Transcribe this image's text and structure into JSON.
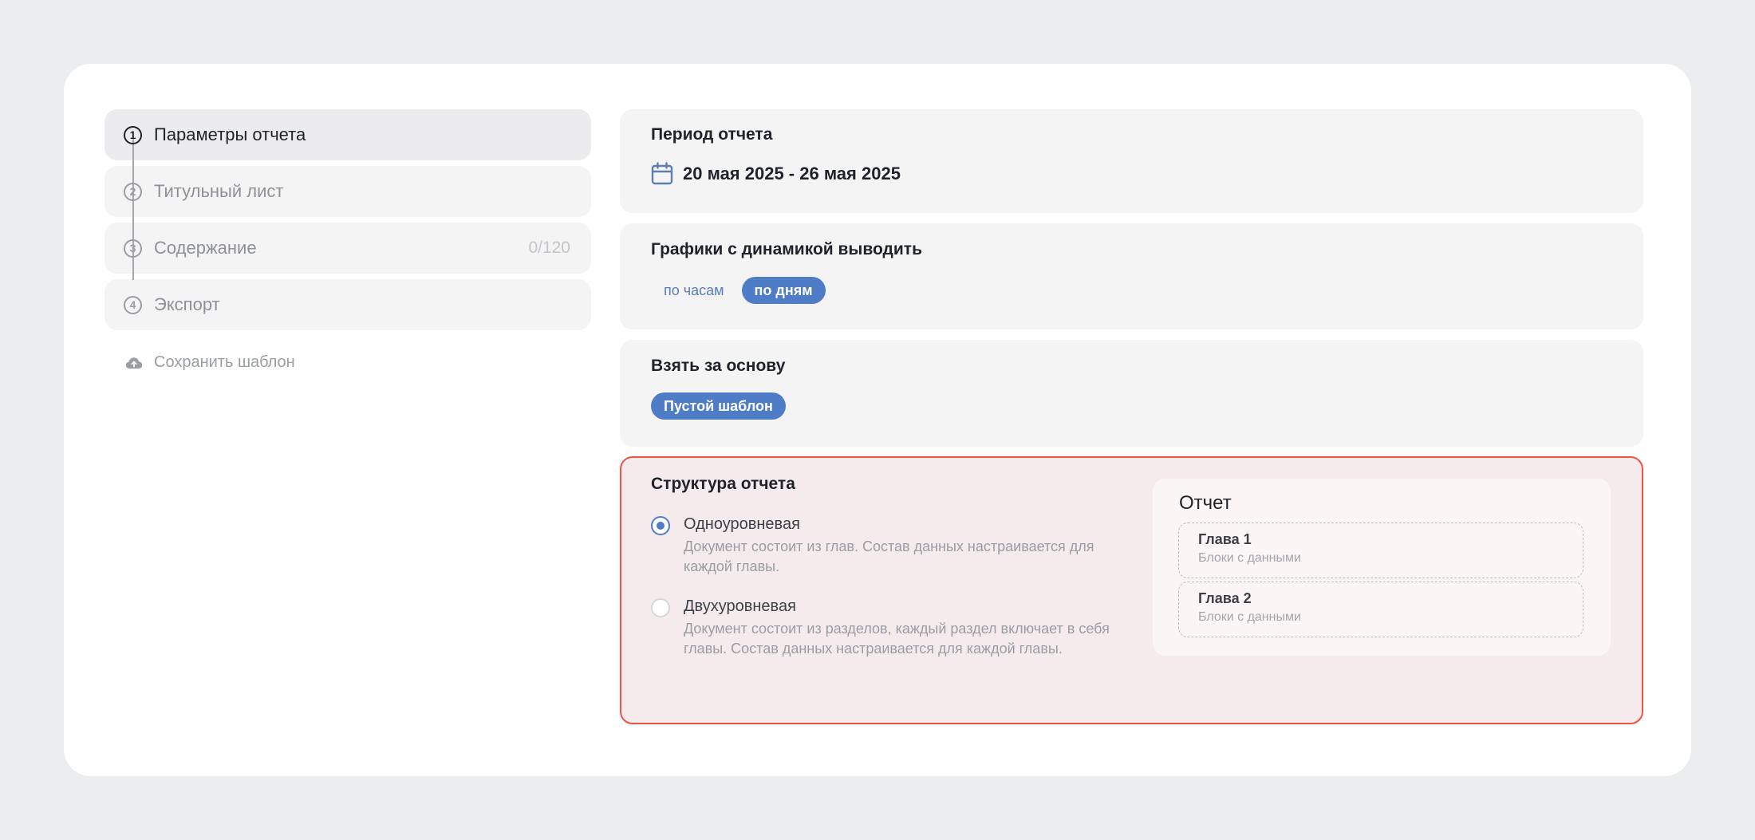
{
  "steps": [
    {
      "number": "1",
      "label": "Параметры отчета",
      "active": true
    },
    {
      "number": "2",
      "label": "Титульный лист",
      "active": false
    },
    {
      "number": "3",
      "label": "Содержание",
      "count": "0/120",
      "active": false
    },
    {
      "number": "4",
      "label": "Экспорт",
      "active": false
    }
  ],
  "save_template_label": "Сохранить шаблон",
  "period": {
    "title": "Период отчета",
    "value": "20 мая 2025 - 26 мая 2025"
  },
  "charts": {
    "title": "Графики с динамикой выводить",
    "options": [
      "по часам",
      "по дням"
    ],
    "selected": "по дням"
  },
  "base": {
    "title": "Взять за основу",
    "selected": "Пустой шаблон"
  },
  "structure": {
    "title": "Структура отчета",
    "options": [
      {
        "title": "Одноуровневая",
        "description": "Документ состоит из глав. Состав данных настраивается для каждой главы.",
        "checked": true
      },
      {
        "title": "Двухуровневая",
        "description": "Документ состоит из разделов, каждый раздел включает в себя главы. Состав данных настраивается для каждой главы.",
        "checked": false
      }
    ],
    "preview": {
      "title": "Отчет",
      "chapters": [
        {
          "title": "Глава 1",
          "subtitle": "Блоки с данными"
        },
        {
          "title": "Глава 2",
          "subtitle": "Блоки с данными"
        }
      ]
    }
  },
  "colors": {
    "accent": "#4F7CC6",
    "highlight_border": "#EE5243",
    "background": "#ECEDEF"
  }
}
